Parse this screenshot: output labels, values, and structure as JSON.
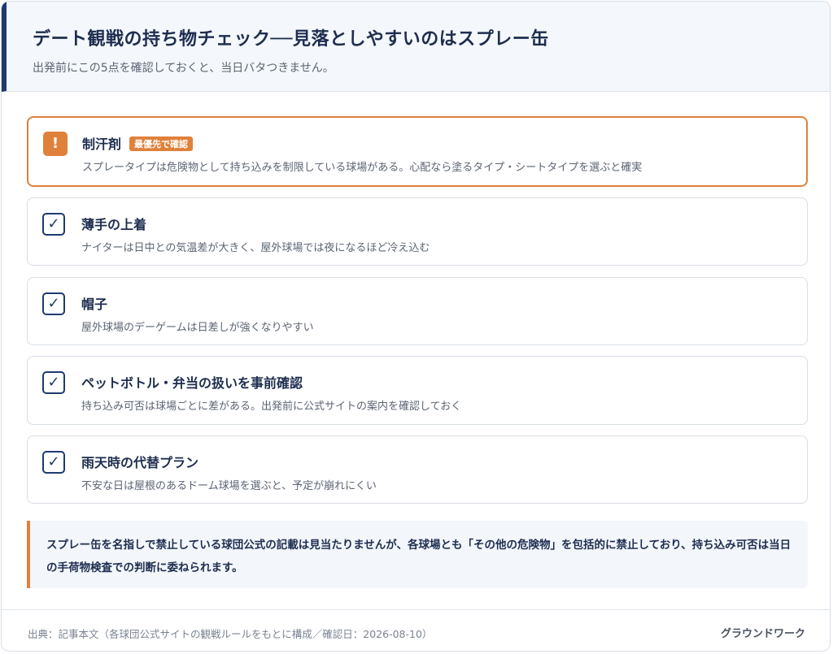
{
  "header": {
    "title": "デート観戦の持ち物チェック──見落としやすいのはスプレー缶",
    "subtitle": "出発前にこの5点を確認しておくと、当日バタつきません。"
  },
  "items": [
    {
      "name": "制汗剤",
      "badge": "最優先で確認",
      "icon": "!",
      "desc": "スプレータイプは危険物として持ち込みを制限している球場がある。心配なら塗るタイプ・シートタイプを選ぶと確実"
    },
    {
      "name": "薄手の上着",
      "icon": "✓",
      "desc": "ナイターは日中との気温差が大きく、屋外球場では夜になるほど冷え込む"
    },
    {
      "name": "帽子",
      "icon": "✓",
      "desc": "屋外球場のデーゲームは日差しが強くなりやすい"
    },
    {
      "name": "ペットボトル・弁当の扱いを事前確認",
      "icon": "✓",
      "desc": "持ち込み可否は球場ごとに差がある。出発前に公式サイトの案内を確認しておく"
    },
    {
      "name": "雨天時の代替プラン",
      "icon": "✓",
      "desc": "不安な日は屋根のあるドーム球場を選ぶと、予定が崩れにくい"
    }
  ],
  "note": {
    "text": "スプレー缶を名指しで禁止している球団公式の記載は見当たりませんが、各球場とも「その他の危険物」を包括的に禁止しており、持ち込み可否は当日の手荷物検査での判断に委ねられます。"
  },
  "footer": {
    "source": "出典：記事本文（各球団公式サイトの観戦ルールをもとに構成／確認日：2026-08-10）",
    "brand": "グラウンドワーク"
  },
  "colors": {
    "accent": "#e0813b",
    "navy": "#1e3a6e"
  }
}
